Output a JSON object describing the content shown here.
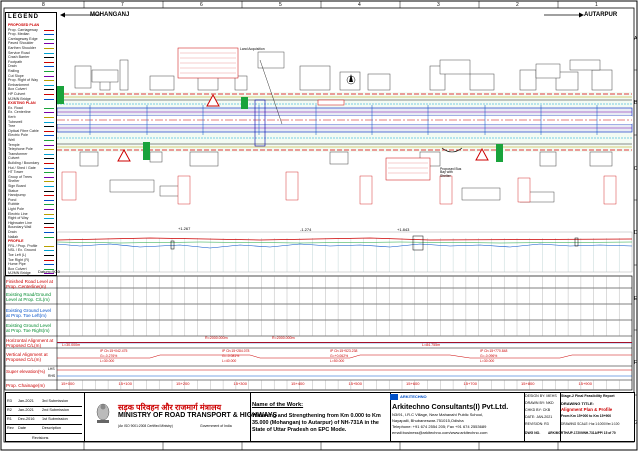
{
  "places": {
    "left": "MOHANGANJ",
    "right": "AUTARPUR"
  },
  "legend": {
    "title": "LEGEND",
    "proposed_heading": "PROPOSED PLAN",
    "existing_heading": "EXISTING PLAN",
    "profile_heading": "PROFILE",
    "proposed_items": [
      "Prop. Carriageway",
      "Prop. Median",
      "Carriageway Edge",
      "Paved Shoulder",
      "Earthen Shoulder",
      "Service Road",
      "Crash Barrier",
      "Footpath",
      "Drain",
      "Railing",
      "Cut Slope",
      "Prop. Right of Way",
      "Embankment",
      "Box Culvert",
      "HP Culvert",
      "MJ/MN Bridge"
    ],
    "existing_items": [
      "Ex. Road",
      "Ex. Centerline",
      "Kerb",
      "Tubewell",
      "Tree",
      "Optical Fibre Cable",
      "Electric Pole",
      "Well",
      "Temple",
      "Telephone Pole",
      "Transformer",
      "Culvert",
      "Building / Boundary",
      "Hut / Shed / Gate",
      "HT Tower",
      "Group of Trees",
      "Shelter",
      "Sign Board",
      "Statue",
      "Handpump",
      "Pond",
      "Rubble",
      "Light Pole",
      "Electric Line",
      "Right of Way",
      "Highwater Line",
      "Boundary Wall",
      "Drain",
      "Nallah"
    ],
    "profile_items": [
      "FRL / Prop. Profile",
      "NSL / Ex. Ground",
      "Toe Left (L)",
      "Toe Right (R)",
      "Hume Pipe",
      "Box Culvert",
      "MJ/MN Bridge"
    ]
  },
  "grid": {
    "top": [
      "8",
      "7",
      "6",
      "5",
      "4",
      "3",
      "2",
      "1"
    ],
    "side": [
      "A",
      "B",
      "C",
      "D",
      "E",
      "F",
      "G"
    ]
  },
  "plan_notes": {
    "datum": "Datum=90.0",
    "chainage_marks": [
      "15+000",
      "15+100",
      "15+200",
      "15+300",
      "15+400",
      "15+500",
      "15+600",
      "15+700",
      "15+800",
      "15+900"
    ],
    "slope_labels": [
      "+1.267",
      "-1.274",
      "+1.843"
    ],
    "label_shed": "Proposed Bus Bay with Shelter",
    "label_land": "Land Acquisition"
  },
  "table_rows": [
    {
      "label": "Finished Road Level at Prop. Centerline(m)",
      "color": "red"
    },
    {
      "label": "Existing Road/Ground Level at Prop. C/L(m)",
      "color": "green"
    },
    {
      "label": "Existing Ground Level at Prop. Toe Left(m)",
      "color": "blue"
    },
    {
      "label": "Existing Ground Level at Prop. Toe Right(m)",
      "color": "green"
    },
    {
      "label": "Horizontal Alignment at Proposed C/L(m)",
      "color": "red"
    },
    {
      "label": "Vertical Alignment at Proposed C/L(m)",
      "color": "red"
    },
    {
      "label": "Super elevation(%)",
      "color": "red"
    },
    {
      "label": "Prop. Chainage(m)",
      "color": "red"
    }
  ],
  "superelevation_tags": [
    "LHS",
    "RHS"
  ],
  "horizontal_alignment": [
    "R=2000.000m",
    "L=30.000m",
    "R=2000.000m",
    "L=84.755m"
  ],
  "vertical_alignment": [
    {
      "ip": "IP Ch:15+042.475",
      "g1": "G=-0.276%",
      "len": "L=30.000"
    },
    {
      "ip": "IP Ch:15+284.078",
      "g1": "G=-0.081%",
      "len": "L=40.000"
    },
    {
      "ip": "IP Ch:15+523.238",
      "g1": "G=+0.062%",
      "len": "L=50.000"
    },
    {
      "ip": "IP Ch:15+770.848",
      "g1": "G=-0.096%",
      "len": "L=30.000"
    }
  ],
  "revisions": [
    {
      "no": "R3",
      "date": "Jan-2021",
      "desc": "3rd Submission"
    },
    {
      "no": "R2",
      "date": "Jan-2021",
      "desc": "2nd Submission"
    },
    {
      "no": "R1",
      "date": "Dec-2016",
      "desc": "1st Submission"
    },
    {
      "no": "Rev",
      "date": "Date",
      "desc": "Description"
    }
  ],
  "revisions_caption": "Revisions",
  "client": {
    "hindi": "सड़क परिवहन और राजमार्ग मंत्रालय",
    "english": "MINISTRY OF ROAD TRANSPORT & HIGHWAYS",
    "gov": "Government of India",
    "iso": "(An ISO 9001:2008 Certified Ministry)"
  },
  "work": {
    "label": "Name of the Work:",
    "desc": "Widening and Strengthening from Km 0.000 to Km 35.000 (Mohanganj to Autarpur) of NH-731A in the State of Uttar Pradesh on EPC Mode."
  },
  "consultant": {
    "label": "ARKITECHNO",
    "name": "Arkitechno Consultants(I) Pvt.Ltd.",
    "addr1": "N3/91, I.R.C Village, Near Mahanahi Public School,",
    "addr2": "Nayapalli, Bhubaneswar-751015,Odisha",
    "phone": "Telephone: +91 674 2554 205; Fax +91 674 2553689",
    "email": "email:business@arkitechno.com/www.arkitechno.com"
  },
  "title_block": {
    "design_by": "DESIGN BY: MEHS",
    "drawn_by": "DRAWN BY: NKD",
    "checked_by": "CHKD BY: CKB",
    "date": "DATE: JAN-2021",
    "revision": "REVISION: R3",
    "stage": "Stage-2 Final Feasibility Report",
    "drawing_title_label": "DRAWING TITLE:",
    "drawing_title": "Alignment Plan & Profile",
    "drawing_range": "From Km 15+000 to Km 15+900",
    "scale": "DRAWING SCALE: Hor.1:1000/Ver.1:100",
    "dwg_no_label": "DWG NO.",
    "dwg_no": "ARK/MORTH/UP-17209/NH-731A/PP/ 15 of 70"
  }
}
